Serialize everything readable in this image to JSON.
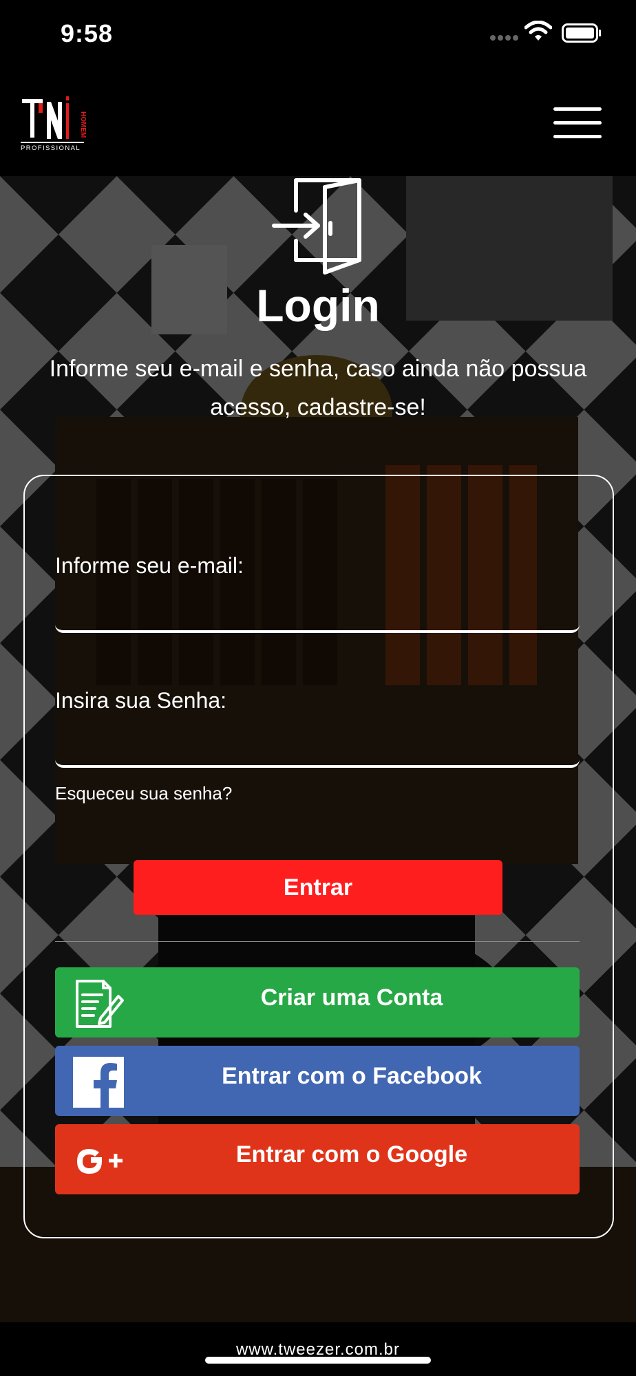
{
  "status_bar": {
    "time": "9:58",
    "signal_icon": "signal-icon",
    "wifi_icon": "wifi-icon",
    "battery_icon": "battery-icon"
  },
  "header": {
    "logo_icon": "tn-homem-profissional-logo",
    "menu_icon": "hamburger-menu-icon"
  },
  "login": {
    "icon": "door-enter-icon",
    "title": "Login",
    "subtitle": "Informe seu e-mail e senha, caso ainda não possua acesso, cadastre-se!"
  },
  "form": {
    "email_label": "Informe seu e-mail:",
    "email_value": "",
    "password_label": "Insira sua Senha:",
    "password_value": "",
    "forgot_link": "Esqueceu sua senha?",
    "submit_label": "Entrar"
  },
  "social": {
    "create_account": {
      "label": "Criar uma Conta",
      "icon": "document-edit-icon"
    },
    "facebook": {
      "label": "Entrar com o Facebook",
      "icon": "facebook-icon"
    },
    "google": {
      "label": "Entrar com o Google",
      "icon": "google-plus-icon"
    }
  },
  "colors": {
    "entrar": "#ff1e1e",
    "criar": "#27a846",
    "facebook": "#4267b2",
    "google": "#e0341a"
  },
  "footer": {
    "url": "www.tweezer.com.br"
  }
}
